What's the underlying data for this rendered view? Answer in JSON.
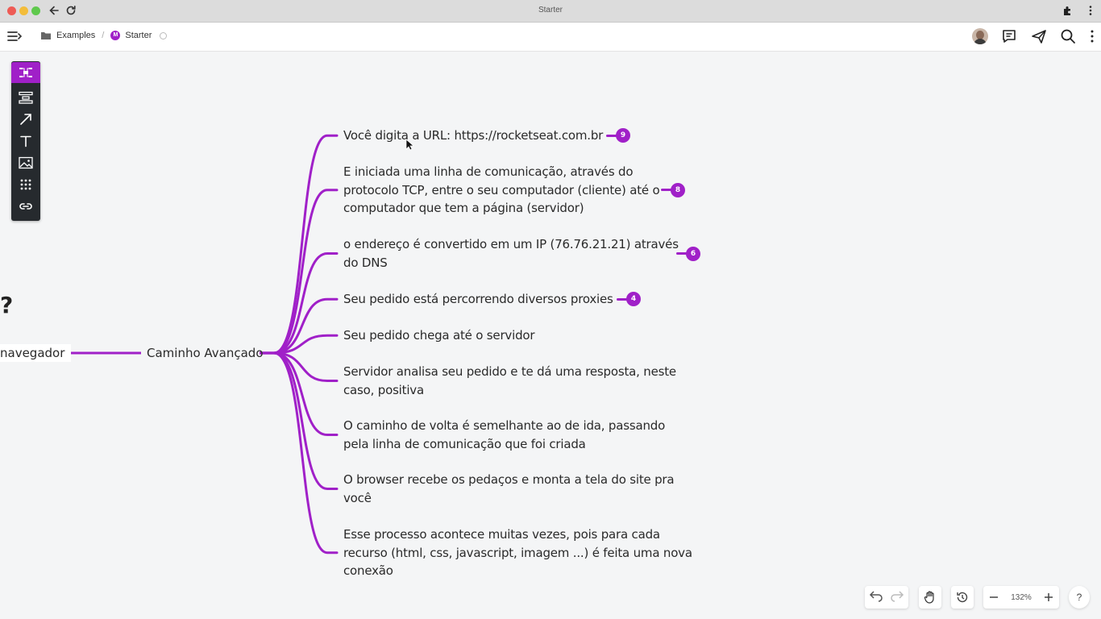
{
  "window": {
    "title": "Starter"
  },
  "breadcrumb": {
    "folder": "Examples",
    "separator": "/",
    "doc_badge": "M",
    "doc": "Starter"
  },
  "header_icons": [
    "avatar",
    "comments-icon",
    "share-icon",
    "search-icon",
    "more-vertical-icon"
  ],
  "toolbar": {
    "tools": [
      "mindmap-icon",
      "structure-icon",
      "arrow-icon",
      "text-icon",
      "image-icon",
      "grid-icon",
      "link-icon"
    ],
    "active": "mindmap-icon"
  },
  "mindmap": {
    "accent": "#a020c8",
    "question_mark": "?",
    "left_node": "navegador",
    "center_node": "Caminho Avançado",
    "children": [
      {
        "lines": [
          "Você digita a URL: https://rocketseat.com.br"
        ],
        "badge": "9"
      },
      {
        "lines": [
          "E iniciada uma linha de comunicação, através do",
          "protocolo TCP, entre o seu computador (cliente) até o",
          "computador que tem a página (servidor)"
        ],
        "badge": "8"
      },
      {
        "lines": [
          "o endereço é convertido em um IP (76.76.21.21) através",
          "do DNS"
        ],
        "badge": "6"
      },
      {
        "lines": [
          "Seu pedido está percorrendo diversos proxies"
        ],
        "badge": "4"
      },
      {
        "lines": [
          "Seu pedido chega até o servidor"
        ]
      },
      {
        "lines": [
          "Servidor analisa seu pedido e te dá uma resposta, neste",
          "caso, positiva"
        ]
      },
      {
        "lines": [
          "O caminho de volta é semelhante ao de ida, passando",
          "pela linha de comunicação que foi criada"
        ]
      },
      {
        "lines": [
          "O browser recebe os pedaços e monta a tela do site pra",
          "você"
        ]
      },
      {
        "lines": [
          "Esse processo acontece muitas vezes, pois para cada",
          "recurso (html, css, javascript, imagem ...) é feita uma nova",
          "conexão"
        ]
      }
    ]
  },
  "bottom": {
    "zoom": "132%",
    "help": "?"
  }
}
